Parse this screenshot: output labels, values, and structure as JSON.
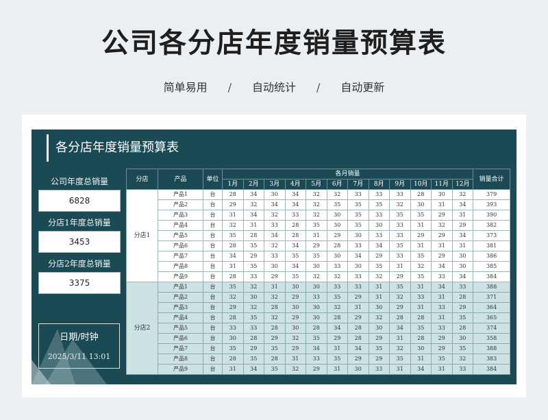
{
  "header": {
    "title": "公司各分店年度销量预算表",
    "tags": [
      "简单易用",
      "自动统计",
      "自动更新"
    ],
    "separator": "/"
  },
  "panel": {
    "title": "各分店年度销量预算表"
  },
  "summary": {
    "company_total_label": "公司年度总销量",
    "company_total_value": "6828",
    "store1_total_label": "分店1年度总销量",
    "store1_total_value": "3453",
    "store2_total_label": "分店2年度总销量",
    "store2_total_value": "3375"
  },
  "datetime": {
    "label": "日期/时钟",
    "value": "2025/3/11  13:01"
  },
  "table": {
    "col_store": "分店",
    "col_product": "产品",
    "col_unit": "单位",
    "col_monthly": "各月销量",
    "col_total": "销量合计",
    "months": [
      "1月",
      "2月",
      "3月",
      "4月",
      "5月",
      "6月",
      "7月",
      "8月",
      "9月",
      "10月",
      "11月",
      "12月"
    ],
    "stores": [
      {
        "name": "分店1",
        "rows": [
          {
            "product": "产品1",
            "unit": "台",
            "values": [
              28,
              34,
              30,
              34,
              32,
              32,
              33,
              33,
              33,
              28,
              30,
              32
            ],
            "total": 379
          },
          {
            "product": "产品2",
            "unit": "台",
            "values": [
              29,
              32,
              34,
              34,
              32,
              35,
              35,
              35,
              32,
              30,
              31,
              34
            ],
            "total": 393
          },
          {
            "product": "产品3",
            "unit": "台",
            "values": [
              31,
              34,
              32,
              33,
              32,
              30,
              35,
              33,
              35,
              35,
              29,
              31
            ],
            "total": 390
          },
          {
            "product": "产品4",
            "unit": "台",
            "values": [
              32,
              31,
              33,
              28,
              35,
              30,
              35,
              30,
              33,
              31,
              32,
              29
            ],
            "total": 382
          },
          {
            "product": "产品5",
            "unit": "台",
            "values": [
              35,
              28,
              34,
              28,
              31,
              29,
              30,
              33,
              33,
              29,
              29,
              34
            ],
            "total": 373
          },
          {
            "product": "产品6",
            "unit": "台",
            "values": [
              28,
              35,
              32,
              34,
              29,
              28,
              33,
              34,
              35,
              31,
              31,
              31
            ],
            "total": 381
          },
          {
            "product": "产品7",
            "unit": "台",
            "values": [
              34,
              29,
              33,
              35,
              35,
              30,
              34,
              29,
              33,
              35,
              29,
              30
            ],
            "total": 386
          },
          {
            "product": "产品8",
            "unit": "台",
            "values": [
              31,
              35,
              30,
              34,
              30,
              33,
              30,
              35,
              31,
              32,
              34,
              30
            ],
            "total": 385
          },
          {
            "product": "产品9",
            "unit": "台",
            "values": [
              28,
              33,
              29,
              35,
              32,
              32,
              33,
              32,
              29,
              35,
              33,
              34
            ],
            "total": 384
          }
        ]
      },
      {
        "name": "分店2",
        "rows": [
          {
            "product": "产品1",
            "unit": "台",
            "values": [
              35,
              32,
              31,
              30,
              30,
              33,
              33,
              31,
              35,
              31,
              34,
              33
            ],
            "total": 388
          },
          {
            "product": "产品2",
            "unit": "台",
            "values": [
              32,
              30,
              32,
              29,
              33,
              35,
              29,
              31,
              32,
              33,
              31,
              28
            ],
            "total": 371
          },
          {
            "product": "产品3",
            "unit": "台",
            "values": [
              29,
              32,
              28,
              30,
              30,
              32,
              31,
              30,
              29,
              31,
              33,
              29
            ],
            "total": 364
          },
          {
            "product": "产品4",
            "unit": "台",
            "values": [
              28,
              35,
              32,
              29,
              30,
              28,
              29,
              32,
              28,
              28,
              31,
              35
            ],
            "total": 365
          },
          {
            "product": "产品5",
            "unit": "台",
            "values": [
              33,
              33,
              28,
              30,
              28,
              34,
              28,
              30,
              34,
              35,
              33,
              28
            ],
            "total": 374
          },
          {
            "product": "产品6",
            "unit": "台",
            "values": [
              30,
              28,
              29,
              32,
              35,
              29,
              28,
              29,
              31,
              28,
              29,
              30
            ],
            "total": 358
          },
          {
            "product": "产品7",
            "unit": "台",
            "values": [
              35,
              29,
              35,
              29,
              34,
              31,
              34,
              35,
              32,
              30,
              29,
              35
            ],
            "total": 388
          },
          {
            "product": "产品8",
            "unit": "台",
            "values": [
              28,
              35,
              28,
              31,
              33,
              35,
              29,
              29,
              35,
              31,
              35,
              32
            ],
            "total": 383
          },
          {
            "product": "产品9",
            "unit": "台",
            "values": [
              31,
              34,
              35,
              32,
              29,
              31,
              30,
              33,
              31,
              34,
              31,
              33
            ],
            "total": 384
          }
        ]
      }
    ]
  },
  "colors": {
    "panel_bg": "#1b4a55",
    "store2_bg": "#cde2e3",
    "page_bg": "#eceff2"
  }
}
